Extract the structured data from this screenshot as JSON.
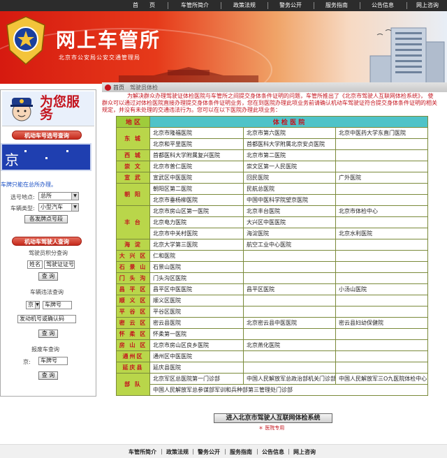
{
  "topnav": {
    "items": [
      "首　　页",
      "车管所简介",
      "政策法规",
      "警务公开",
      "服务指南",
      "公告信息",
      "网上咨询"
    ]
  },
  "banner": {
    "title": "网上车管所",
    "subtitle": "北京市公安局公安交通管理局"
  },
  "breadcrumb": {
    "home": "首页",
    "current": "驾驶员体检"
  },
  "sidebar": {
    "promo_text": "为您服务",
    "plate_query_title": "机动车号选号查询",
    "plate_char": "京",
    "plate_note": "车牌只能在总所办理。",
    "location_label": "选号地点:",
    "location_value": "总所",
    "vehicle_type_label": "车辆类型:",
    "vehicle_type_value": "小型汽车",
    "alt_plate_button": "各发牌点号段",
    "driver_query_title": "机动车驾驶人查询",
    "points_label": "驾驶员积分查询",
    "name_field": "姓名",
    "license_field": "驾驶证证号",
    "query_button": "查 询",
    "violation_label": "车辆违法查询",
    "violation_prefix": "京",
    "violation_plate_field": "车牌号",
    "engine_field": "发动机号或确认码",
    "scrap_label": "报废车查询",
    "scrap_prefix": "京:",
    "scrap_plate_field": "车牌号"
  },
  "intro": "为解决群众办理驾驶证体检医院与车管所之间提交身体条件证明的问题，车管所推出了《北京市驾驶人互联网体检系统》， 使群众可以通过对体检医院直接办理提交身体条件证明业务，您在到医院办理此项业务前请确认机动车驾驶证符合提交身体条件证明的相关规定，并没有未处理的交通违法行为。您可以在以下医院办理此项业务：",
  "table": {
    "header_district": "地 区",
    "header_hospital": "体 检 医 院",
    "rows": [
      {
        "district": "东 城",
        "span": 2,
        "cells": [
          [
            "北京市隆福医院",
            "北京市第六医院",
            "北京中医药大学东直门医院"
          ],
          [
            "北京和平里医院",
            "首都医科大学附属北京安贞医院",
            ""
          ]
        ]
      },
      {
        "district": "西 城",
        "span": 1,
        "cells": [
          [
            "首都医科大学附属复兴医院",
            "北京市第二医院",
            ""
          ]
        ]
      },
      {
        "district": "崇 文",
        "span": 1,
        "cells": [
          [
            "北京市普仁医院",
            "崇文区第一人民医院",
            ""
          ]
        ]
      },
      {
        "district": "宣 武",
        "span": 1,
        "cells": [
          [
            "宣武区中医医院",
            "回民医院",
            "广外医院"
          ]
        ]
      },
      {
        "district": "朝 阳",
        "span": 2,
        "cells": [
          [
            "朝阳区第二医院",
            "民航总医院",
            ""
          ],
          [
            "北京市垂杨柳医院",
            "中国中医科学院望京医院",
            ""
          ]
        ]
      },
      {
        "district": "丰 台",
        "span": 3,
        "cells": [
          [
            "北京市房山区第一医院",
            "北京丰台医院",
            "北京市体检中心"
          ],
          [
            "北京电力医院",
            "大兴区中医医院",
            ""
          ],
          [
            "北京市中关村医院",
            "海淀医院",
            "北京水利医院"
          ]
        ]
      },
      {
        "district": "海 淀",
        "span": 1,
        "cells": [
          [
            "北京大学第三医院",
            "航空工业中心医院",
            ""
          ]
        ]
      },
      {
        "district": "大 兴 区",
        "span": 1,
        "cells": [
          [
            "仁和医院",
            "",
            ""
          ]
        ]
      },
      {
        "district": "石 景 山",
        "span": 1,
        "cells": [
          [
            "石景山医院",
            "",
            ""
          ]
        ]
      },
      {
        "district": "门 头 沟",
        "span": 1,
        "cells": [
          [
            "门头沟区医院",
            "",
            ""
          ]
        ]
      },
      {
        "district": "昌 平 区",
        "span": 1,
        "cells": [
          [
            "昌平区中医医院",
            "昌平区医院",
            "小汤山医院"
          ]
        ]
      },
      {
        "district": "顺 义 区",
        "span": 1,
        "cells": [
          [
            "顺义区医院",
            "",
            ""
          ]
        ]
      },
      {
        "district": "平 谷 区",
        "span": 1,
        "cells": [
          [
            "平谷区医院",
            "",
            ""
          ]
        ]
      },
      {
        "district": "密 云 区",
        "span": 1,
        "cells": [
          [
            "密云县医院",
            "北京密云县中医医院",
            "密云县妇幼保健院"
          ]
        ]
      },
      {
        "district": "怀 柔 区",
        "span": 1,
        "cells": [
          [
            "怀柔第一医院",
            "",
            ""
          ]
        ]
      },
      {
        "district": "房 山 区",
        "span": 1,
        "cells": [
          [
            "北京市房山区良乡医院",
            "北京燕化医院",
            ""
          ]
        ]
      },
      {
        "district": "通州区",
        "span": 1,
        "cells": [
          [
            "通州区中医医院",
            "",
            ""
          ]
        ]
      },
      {
        "district": "延庆县",
        "span": 1,
        "cells": [
          [
            "延庆县医院",
            "",
            ""
          ]
        ]
      },
      {
        "district": "部 队",
        "span": 2,
        "cells": [
          [
            "北京军区总医院第一门诊部",
            "中国人民解放军总政治部机关门诊部",
            "中国人民解放军三O九医院体检中心"
          ],
          [
            "中国人民解放军总参谋部军训和兵种部第三管理处门诊部",
            "",
            ""
          ]
        ]
      }
    ]
  },
  "entry_button": "进入北京市驾驶人互联网体检系统",
  "entry_note": "＊ 医院专用",
  "footer": {
    "items": [
      "车管所简介",
      "政策法规",
      "警务公开",
      "服务指南",
      "公告信息",
      "网上咨询"
    ]
  },
  "colors": {
    "banner_red": "#d61a10",
    "accent_red": "#c4141e",
    "table_green": "#9fcc3b",
    "header_teal": "#4fc3c8"
  }
}
